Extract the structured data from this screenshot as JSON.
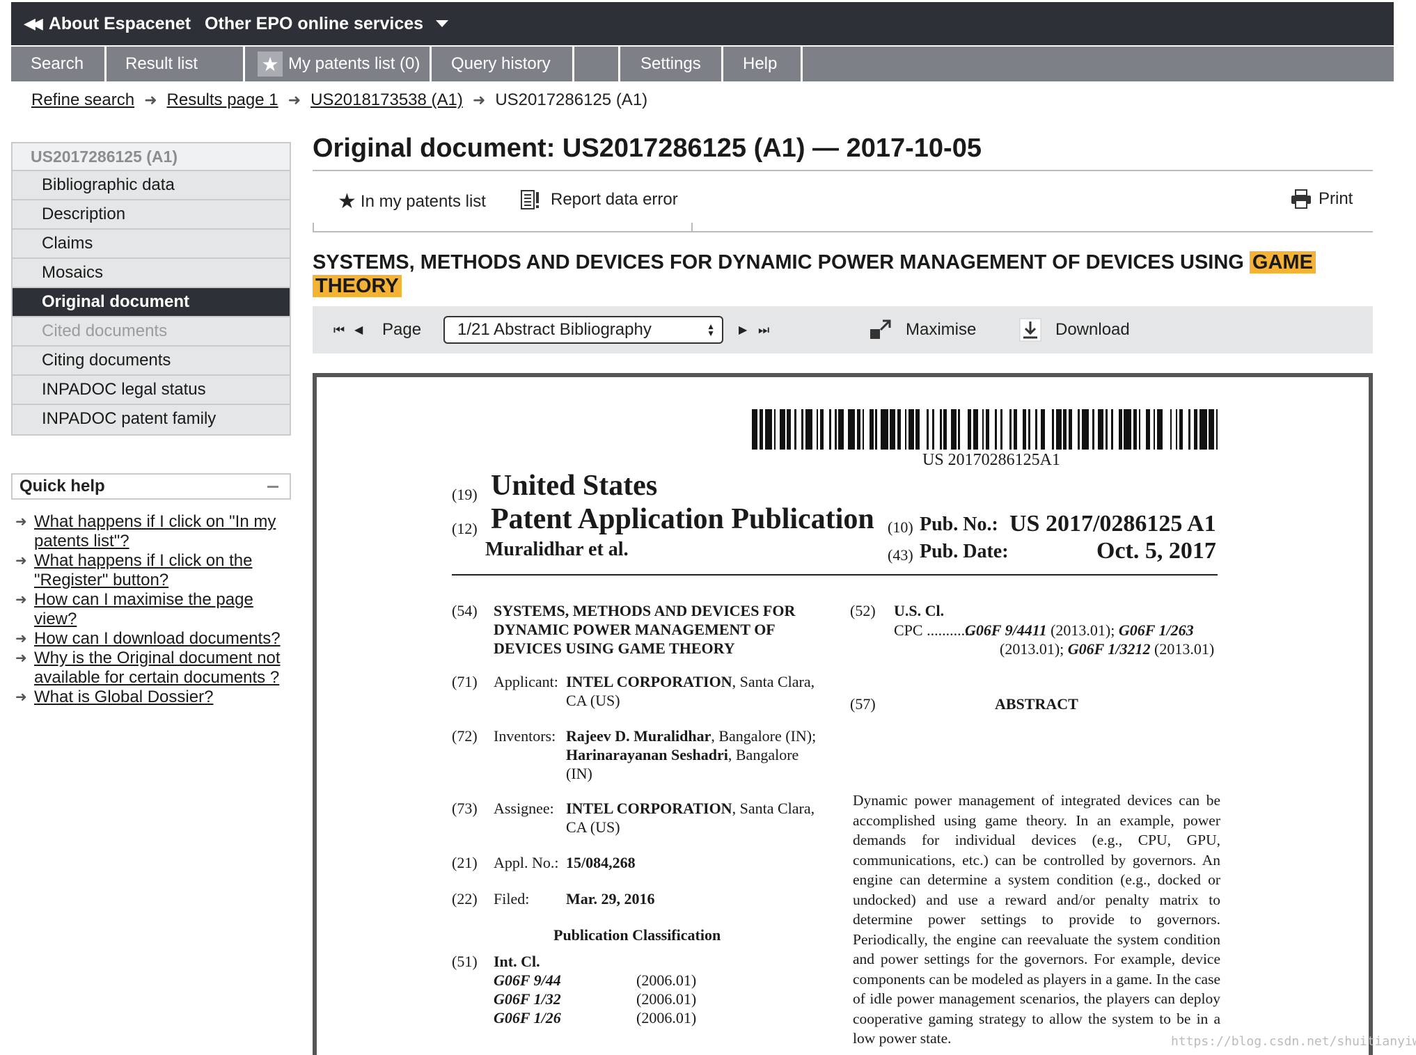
{
  "topbar": {
    "about": "About Espacenet",
    "other": "Other EPO online services"
  },
  "tabs": [
    {
      "label": "Search"
    },
    {
      "label": "Result list"
    },
    {
      "label": "My patents list (0)"
    },
    {
      "label": "Query history"
    },
    {
      "label": ""
    },
    {
      "label": "Settings"
    },
    {
      "label": "Help"
    }
  ],
  "breadcrumb": {
    "refine": "Refine search",
    "results": "Results page 1",
    "prev": "US2018173538 (A1)",
    "current": "US2017286125 (A1)"
  },
  "leftnav": {
    "header": "US2017286125 (A1)",
    "items": [
      "Bibliographic data",
      "Description",
      "Claims",
      "Mosaics",
      "Original document",
      "Cited documents",
      "Citing documents",
      "INPADOC legal status",
      "INPADOC patent family"
    ]
  },
  "quickhelp": {
    "title": "Quick help",
    "links": [
      "What happens if I click on \"In my patents list\"?",
      "What happens if I click on the \"Register\" button?",
      "How can I maximise the page view?",
      "How can I download documents?",
      "Why is the Original document not available for certain documents ?",
      "What is Global Dossier?"
    ]
  },
  "main": {
    "page_title": "Original document: US2017286125 (A1) — 2017-10-05",
    "actions": {
      "in_list": "In my patents list",
      "report": "Report data error",
      "print": "Print"
    },
    "doc_title_pre": "SYSTEMS, METHODS AND DEVICES FOR DYNAMIC POWER MANAGEMENT OF DEVICES USING ",
    "doc_title_hl1": "GAME",
    "doc_title_hl2": "THEORY"
  },
  "viewer": {
    "page_label": "Page",
    "page_select": "1/21 Abstract Bibliography",
    "maximise": "Maximise",
    "download": "Download"
  },
  "doc": {
    "barcode_number": "US 20170286125A1",
    "c19": "(19)",
    "country": "United States",
    "c12": "(12)",
    "pubtype": "Patent Application Publication",
    "authors": "Muralidhar et al.",
    "c10": "(10)",
    "pubno_label": "Pub. No.:",
    "pubno": "US 2017/0286125 A1",
    "c43": "(43)",
    "pubdate_label": "Pub. Date:",
    "pubdate": "Oct. 5, 2017",
    "c54": "(54)",
    "title_lines": [
      "SYSTEMS, METHODS AND DEVICES FOR",
      "DYNAMIC POWER MANAGEMENT OF",
      "DEVICES USING GAME THEORY"
    ],
    "c71": "(71)",
    "applicant_label": "Applicant:",
    "applicant_name": "INTEL CORPORATION",
    "applicant_rest": ", Santa Clara,",
    "applicant_line2": "CA (US)",
    "c72": "(72)",
    "inventors_label": "Inventors:",
    "inv1_name": "Rajeev D. Muralidhar",
    "inv1_rest": ", Bangalore (IN);",
    "inv2_name": "Harinarayanan Seshadri",
    "inv2_rest": ", Bangalore",
    "inv_line3": "(IN)",
    "c73": "(73)",
    "assignee_label": "Assignee:",
    "assignee_name": "INTEL CORPORATION",
    "assignee_rest": ", Santa Clara,",
    "assignee_line2": "CA (US)",
    "c21": "(21)",
    "appl_label": "Appl. No.:",
    "appl_no": "15/084,268",
    "c22": "(22)",
    "filed_label": "Filed:",
    "filed": "Mar. 29, 2016",
    "pub_class_heading": "Publication Classification",
    "c51": "(51)",
    "intcl_label": "Int. Cl.",
    "intcl": [
      {
        "code": "G06F 9/44",
        "year": "(2006.01)"
      },
      {
        "code": "G06F 1/32",
        "year": "(2006.01)"
      },
      {
        "code": "G06F 1/26",
        "year": "(2006.01)"
      }
    ],
    "c52": "(52)",
    "uscl_label": "U.S. Cl.",
    "cpc_label": "CPC ............",
    "cpc1": "G06F 9/4411",
    "cpc1y": " (2013.01); ",
    "cpc2": "G06F 1/263",
    "cpc2y": "(2013.01); ",
    "cpc3": "G06F 1/3212",
    "cpc3y": " (2013.01)",
    "c57": "(57)",
    "abstract_heading": "ABSTRACT",
    "abstract": "Dynamic power management of integrated devices can be accomplished using game theory. In an example, power demands for individual devices (e.g., CPU, GPU, communications, etc.) can be controlled by governors. An engine can determine a system condition (e.g., docked or undocked) and use a reward and/or penalty matrix to determine power settings to provide to governors. Periodically, the engine can reevaluate the system condition and power settings for the governors. For example, device components can be modeled as players in a game. In the case of idle power management scenarios, the players can deploy cooperative gaming strategy to allow the system to be in a low power state."
  },
  "watermark": "https://blog.csdn.net/shuitianyiwu"
}
